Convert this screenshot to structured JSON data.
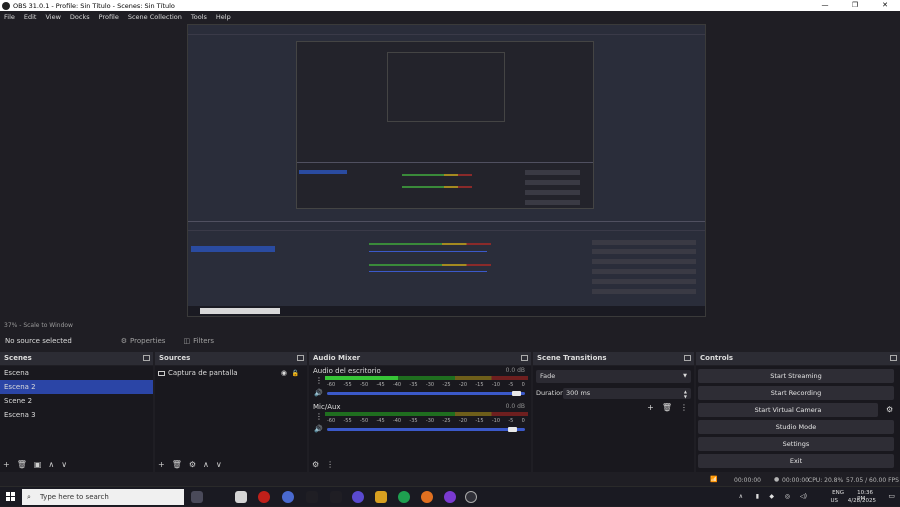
{
  "window": {
    "title": "OBS 31.0.1 - Profile: Sin Título - Scenes: Sin Título"
  },
  "menu": [
    "File",
    "Edit",
    "View",
    "Docks",
    "Profile",
    "Scene Collection",
    "Tools",
    "Help"
  ],
  "preview": {
    "status": "37% - Scale to Window"
  },
  "source_toolbar": {
    "no_source": "No source selected",
    "properties": "Properties",
    "filters": "Filters"
  },
  "scenes": {
    "header": "Scenes",
    "items": [
      "Escena",
      "Escena 2",
      "Scene 2",
      "Escena 3"
    ],
    "selected_index": 1
  },
  "sources": {
    "header": "Sources",
    "items": [
      {
        "name": "Captura de pantalla"
      }
    ]
  },
  "mixer": {
    "header": "Audio Mixer",
    "scale": [
      "-60",
      "-55",
      "-50",
      "-45",
      "-40",
      "-35",
      "-30",
      "-25",
      "-20",
      "-15",
      "-10",
      "-5",
      "0"
    ],
    "channels": [
      {
        "name": "Audio del escritorio",
        "db": "0.0 dB",
        "level": 0.36,
        "volume": 0.98
      },
      {
        "name": "Mic/Aux",
        "db": "0.0 dB",
        "level": 0.0,
        "volume": 0.96
      }
    ]
  },
  "transitions": {
    "header": "Scene Transitions",
    "type": "Fade",
    "duration_label": "Duration",
    "duration": "300 ms"
  },
  "controls": {
    "header": "Controls",
    "buttons": [
      "Start Streaming",
      "Start Recording",
      "Start Virtual Camera",
      "Studio Mode",
      "Settings",
      "Exit"
    ]
  },
  "statusbar": {
    "stream_time": "00:00:00",
    "rec_time": "00:00:00",
    "cpu": "CPU: 20.8%",
    "fps": "57.05 / 60.00 FPS"
  },
  "taskbar": {
    "search_placeholder": "Type here to search",
    "lang": "ENG",
    "region": "US",
    "time": "10:36 PM",
    "date": "4/28/2025"
  },
  "colors": {
    "accent": "#2b45a6",
    "background": "#1f1e24",
    "panel": "#2c2c34"
  }
}
